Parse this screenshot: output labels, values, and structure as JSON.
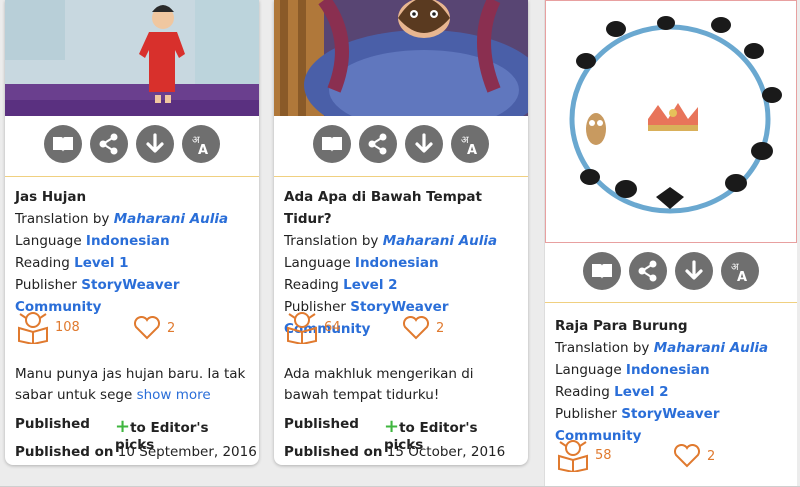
{
  "books": [
    {
      "title": "Jas Hujan",
      "translation_prefix": "Translation by",
      "translator": "Maharani Aulia",
      "language_label": "Language",
      "language": "Indonesian",
      "reading_label": "Reading",
      "level": "Level 1",
      "publisher_label": "Publisher",
      "publisher": "StoryWeaver Community",
      "reads": "108",
      "likes": "2",
      "summary": "Manu punya jas hujan baru. Ia tak sabar untuk sege",
      "show_more": "show more",
      "published_label": "Published",
      "editor_picks": "to Editor's picks",
      "published_on_label": "Published on",
      "published_on": "10 September, 2016"
    },
    {
      "title": "Ada Apa di Bawah Tempat Tidur?",
      "translation_prefix": "Translation by",
      "translator": "Maharani Aulia",
      "language_label": "Language",
      "language": "Indonesian",
      "reading_label": "Reading",
      "level": "Level 2",
      "publisher_label": "Publisher",
      "publisher": "StoryWeaver Community",
      "reads": "64",
      "likes": "2",
      "summary": "Ada makhluk mengerikan di bawah tempat tidurku!",
      "published_label": "Published",
      "editor_picks": "to Editor's picks",
      "published_on_label": "Published on",
      "published_on": "15 October, 2016"
    },
    {
      "title": "Raja Para Burung",
      "translation_prefix": "Translation by",
      "translator": "Maharani Aulia",
      "language_label": "Language",
      "language": "Indonesian",
      "reading_label": "Reading",
      "level": "Level 2",
      "publisher_label": "Publisher",
      "publisher": "StoryWeaver Community",
      "reads": "58",
      "likes": "2"
    }
  ],
  "icons": [
    "read-book-icon",
    "share-icon",
    "download-icon",
    "translate-icon",
    "reader-icon",
    "heart-icon",
    "plus-icon"
  ],
  "colors": {
    "link": "#2a6ed8",
    "stat": "#e07a2f",
    "button": "#6f6f6f",
    "plus": "#3fb63f",
    "separator": "#f0d080"
  }
}
